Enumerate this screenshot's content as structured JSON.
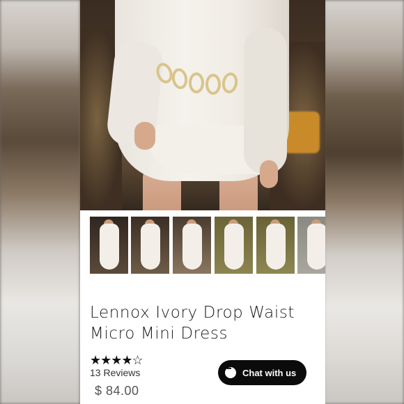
{
  "product": {
    "title_line1": "Lennox Ivory Drop Waist",
    "title_line2": "Micro Mini Dress",
    "rating_stars": "★★★★☆",
    "rating_value": 4.5,
    "reviews": "13 Reviews",
    "price": "$ 84.00"
  },
  "gallery": {
    "thumbnail_count": 6,
    "hero_alt_icon": "product-photo"
  },
  "chat": {
    "label": "Chat with us",
    "icon": "chat-bubble-icon"
  },
  "colors": {
    "button_bg": "#0b0b0b",
    "text_primary": "#1d1d1d",
    "price_text": "#555555"
  }
}
